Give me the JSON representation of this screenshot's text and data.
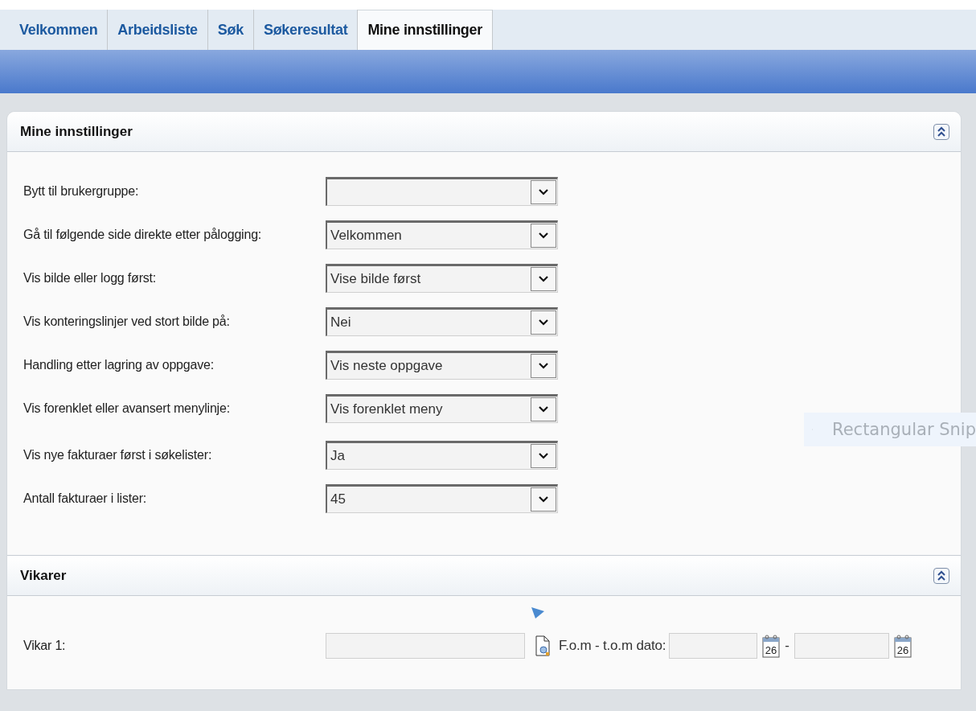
{
  "tabs": [
    {
      "label": "Velkommen",
      "selected": false
    },
    {
      "label": "Arbeidsliste",
      "selected": false
    },
    {
      "label": "Søk",
      "selected": false
    },
    {
      "label": "Søkeresultat",
      "selected": false
    },
    {
      "label": "Mine innstillinger",
      "selected": true
    }
  ],
  "settings_panel": {
    "title": "Mine innstillinger",
    "expanded": true,
    "groups": [
      [
        {
          "label": "Bytt til brukergruppe:"
        },
        {
          "label": "Gå til følgende side direkte etter pålogging:",
          "value": "Velkommen"
        },
        {
          "label": "Vis bilde eller logg først:",
          "value": "Vise bilde først"
        },
        {
          "label": "Vis konteringslinjer ved stort bilde på:",
          "value": "Nei"
        },
        {
          "label": "Handling etter lagring av oppgave:",
          "value": "Vis neste oppgave"
        },
        {
          "label": "Vis forenklet eller avansert menylinje:",
          "value": "Vis forenklet meny"
        }
      ],
      [
        {
          "label": "Vis nye fakturaer først i søkelister:",
          "value": "Ja"
        },
        {
          "label": "Antall fakturaer i lister:",
          "value": "45"
        }
      ]
    ]
  },
  "substitutes_panel": {
    "title": "Vikarer",
    "expanded": true,
    "rows": [
      {
        "label": "Vikar 1:",
        "date_label": "F.o.m - t.o.m dato:",
        "separator": "-",
        "calendar_days": [
          "26",
          "26"
        ]
      }
    ]
  },
  "snip_tooltip": {
    "label": "Rectangular Snip"
  }
}
